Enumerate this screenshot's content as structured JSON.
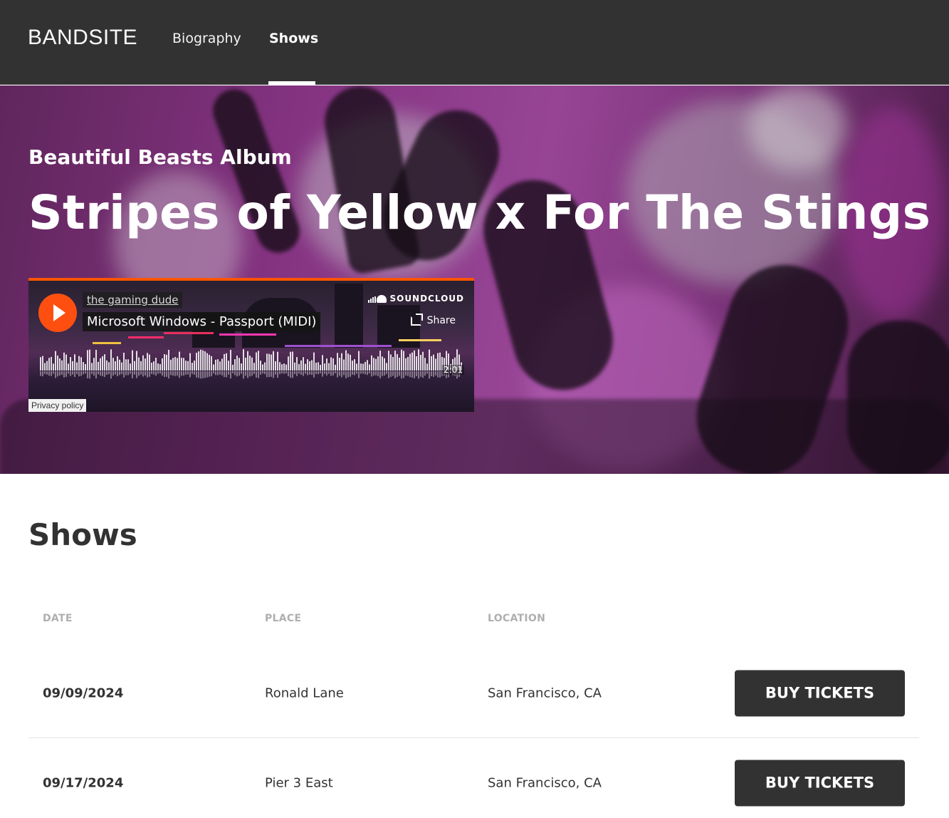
{
  "header": {
    "logo": "BANDSITE",
    "nav": [
      {
        "label": "Biography",
        "active": false
      },
      {
        "label": "Shows",
        "active": true
      }
    ]
  },
  "hero": {
    "subtitle": "Beautiful Beasts Album",
    "title": "Stripes of Yellow x For The Stings"
  },
  "player": {
    "user": "the gaming dude",
    "track": "Microsoft Windows - Passport (MIDI)",
    "brand": "SOUNDCLOUD",
    "share_label": "Share",
    "duration": "2:01",
    "privacy_label": "Privacy policy",
    "accent_color": "#ff5500",
    "icons": [
      "play-icon",
      "soundcloud-icon",
      "share-icon"
    ]
  },
  "shows": {
    "heading": "Shows",
    "columns": [
      "DATE",
      "PLACE",
      "LOCATION"
    ],
    "rows": [
      {
        "date": "09/09/2024",
        "place": "Ronald Lane",
        "location": "San Francisco, CA",
        "button": "BUY TICKETS"
      },
      {
        "date": "09/17/2024",
        "place": "Pier 3 East",
        "location": "San Francisco, CA",
        "button": "BUY TICKETS"
      }
    ]
  },
  "colors": {
    "header_bg": "#323232",
    "button_bg": "#323232",
    "muted_text": "#afafaf"
  }
}
